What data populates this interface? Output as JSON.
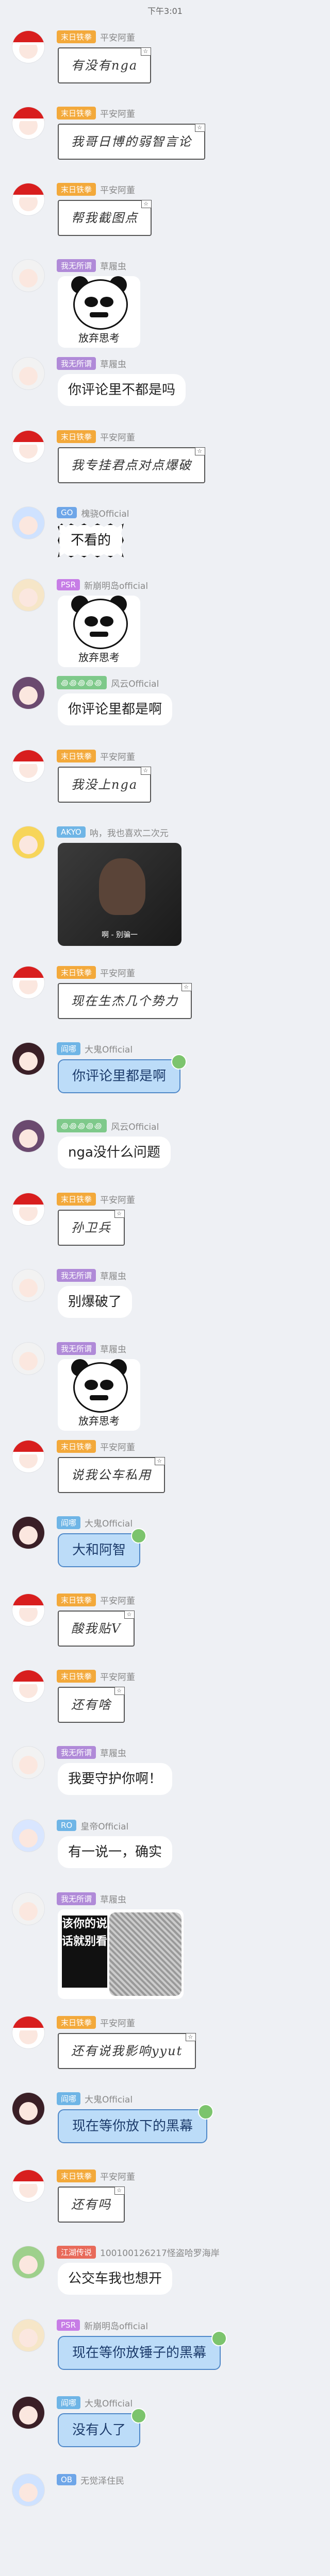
{
  "status_bar": {
    "time": "下午3:01"
  },
  "messages": [
    {
      "type": "hand",
      "avatar": "red",
      "badge": "末日铁拳",
      "badge_color": "orange",
      "sender": "平安阿董",
      "text": "有没有nga"
    },
    {
      "type": "hand",
      "avatar": "red",
      "badge": "末日铁拳",
      "badge_color": "orange",
      "sender": "平安阿董",
      "text": "我哥日博的弱智言论"
    },
    {
      "type": "hand",
      "avatar": "red",
      "badge": "末日铁拳",
      "badge_color": "orange",
      "sender": "平安阿董",
      "text": "帮我截图点"
    },
    {
      "type": "panda",
      "avatar": "white",
      "badge": "我无所谓",
      "badge_color": "purple",
      "sender": "草履虫",
      "caption": "放弃思考"
    },
    {
      "type": "bubble",
      "avatar": "white",
      "badge": "我无所谓",
      "badge_color": "purple",
      "sender": "草履虫",
      "text": "你评论里不都是吗"
    },
    {
      "type": "hand",
      "avatar": "red",
      "badge": "末日铁拳",
      "badge_color": "orange",
      "sender": "平安阿董",
      "text": "我专挂君点对点爆破"
    },
    {
      "type": "spiky",
      "avatar": "anime",
      "badge": "GO",
      "badge_color": "blue",
      "sender": "槐骁Official",
      "text": "不看的"
    },
    {
      "type": "panda",
      "avatar": "panda",
      "badge": "PSR",
      "badge_color": "pink",
      "sender": "新崩明岛official",
      "caption": "放弃思考"
    },
    {
      "type": "bubble",
      "avatar": "purple",
      "badge": "꩜꩜꩜꩜꩜",
      "badge_color": "green",
      "sender": "风云Official",
      "text": "你评论里都是啊"
    },
    {
      "type": "hand",
      "avatar": "red",
      "badge": "末日铁拳",
      "badge_color": "orange",
      "sender": "平安阿董",
      "text": "我没上nga"
    },
    {
      "type": "photo",
      "avatar": "yellow",
      "badge": "AKYO",
      "badge_color": "sky",
      "sender": "呐，我也喜欢二次元",
      "caption": "啊 - 别骗一"
    },
    {
      "type": "hand",
      "avatar": "red",
      "badge": "末日铁拳",
      "badge_color": "orange",
      "sender": "平安阿董",
      "text": "现在生杰几个势力"
    },
    {
      "type": "blue",
      "avatar": "dark",
      "badge": "阎哪",
      "badge_color": "sky",
      "sender": "大鬼Official",
      "text": "你评论里都是啊"
    },
    {
      "type": "bubble",
      "avatar": "purple",
      "badge": "꩜꩜꩜꩜꩜",
      "badge_color": "green",
      "sender": "风云Official",
      "text": "nga没什么问题"
    },
    {
      "type": "hand",
      "avatar": "red",
      "badge": "末日铁拳",
      "badge_color": "orange",
      "sender": "平安阿董",
      "text": "孙卫兵"
    },
    {
      "type": "bubble",
      "avatar": "white",
      "badge": "我无所谓",
      "badge_color": "purple",
      "sender": "草履虫",
      "text": "别爆破了"
    },
    {
      "type": "panda",
      "avatar": "white",
      "badge": "我无所谓",
      "badge_color": "purple",
      "sender": "草履虫",
      "caption": "放弃思考"
    },
    {
      "type": "hand",
      "avatar": "red",
      "badge": "末日铁拳",
      "badge_color": "orange",
      "sender": "平安阿董",
      "text": "说我公车私用"
    },
    {
      "type": "blue",
      "avatar": "dark",
      "badge": "阎哪",
      "badge_color": "sky",
      "sender": "大鬼Official",
      "text": "大和阿智"
    },
    {
      "type": "hand",
      "avatar": "red",
      "badge": "末日铁拳",
      "badge_color": "orange",
      "sender": "平安阿董",
      "text": "酸我贴V"
    },
    {
      "type": "hand",
      "avatar": "red",
      "badge": "末日铁拳",
      "badge_color": "orange",
      "sender": "平安阿董",
      "text": "还有啥"
    },
    {
      "type": "bubble",
      "avatar": "white",
      "badge": "我无所谓",
      "badge_color": "purple",
      "sender": "草履虫",
      "text": "我要守护你啊！"
    },
    {
      "type": "bubble",
      "avatar": "bluehair",
      "badge": "RO",
      "badge_color": "sky",
      "sender": "皇帝Official",
      "text": "有一说一，确实"
    },
    {
      "type": "comic",
      "avatar": "white",
      "badge": "我无所谓",
      "badge_color": "purple",
      "sender": "草履虫",
      "caption": "该你的说话就别看"
    },
    {
      "type": "hand",
      "avatar": "red",
      "badge": "末日铁拳",
      "badge_color": "orange",
      "sender": "平安阿董",
      "text": "还有说我影响yyut"
    },
    {
      "type": "blue",
      "avatar": "dark",
      "badge": "阎哪",
      "badge_color": "sky",
      "sender": "大鬼Official",
      "text": "现在等你放下的黑幕"
    },
    {
      "type": "hand",
      "avatar": "red",
      "badge": "末日铁拳",
      "badge_color": "orange",
      "sender": "平安阿董",
      "text": "还有吗"
    },
    {
      "type": "bubble",
      "avatar": "green",
      "badge": "江湖传说",
      "badge_color": "red",
      "sender": "100100126217怪盗哈罗海岸",
      "text": "公交车我也想开"
    },
    {
      "type": "blue",
      "avatar": "panda",
      "badge": "PSR",
      "badge_color": "pink",
      "sender": "新崩明岛official",
      "text": "现在等你放锤子的黑幕"
    },
    {
      "type": "blue",
      "avatar": "dark",
      "badge": "阎哪",
      "badge_color": "sky",
      "sender": "大鬼Official",
      "text": "没有人了"
    },
    {
      "type": "bubble",
      "avatar": "anime",
      "badge": "OB",
      "badge_color": "blue",
      "sender": "无觉泽住民",
      "text": ""
    }
  ]
}
